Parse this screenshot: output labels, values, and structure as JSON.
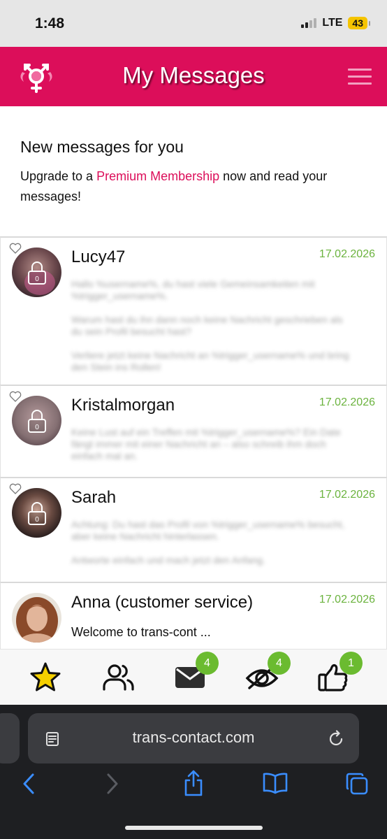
{
  "status_bar": {
    "time": "1:48",
    "network": "LTE",
    "battery": "43"
  },
  "header": {
    "title": "My Messages",
    "logo_icon": "trans-symbol-icon",
    "menu_icon": "hamburger-menu-icon"
  },
  "intro": {
    "heading": "New messages for you",
    "text_before": "Upgrade to a ",
    "link_label": "Premium Membership",
    "text_after": " now and read your messages!"
  },
  "messages": [
    {
      "name": "Lucy47",
      "date": "17.02.2026",
      "lock_count": "0",
      "preview": [
        "Hallo %username%, du hast viele Gemeinsamkeiten mit %trigger_username%.",
        "Warum hast du ihn dann noch keine Nachricht geschrieben als du sein Profil besucht hast?",
        "Verliere jetzt keine Nachricht an %trigger_username% und bring den Stein ins Rollen!"
      ]
    },
    {
      "name": "Kristalmorgan",
      "date": "17.02.2026",
      "lock_count": "0",
      "preview": [
        "Keine Lust auf ein Treffen mit %trigger_username%? Ein Date fängt immer mit einer Nachricht an – also schreib ihm doch einfach mal an."
      ]
    },
    {
      "name": "Sarah",
      "date": "17.02.2026",
      "lock_count": "0",
      "preview": [
        "Achtung: Du hast das Profil von %trigger_username% besucht, aber keine Nachricht hinterlassen.",
        "Antworte einfach und mach jetzt den Anfang."
      ]
    },
    {
      "name": "Anna (customer service)",
      "date": "17.02.2026",
      "preview_text": "Welcome to trans-cont ..."
    }
  ],
  "bottom_nav": [
    {
      "icon": "star-icon",
      "badge": null
    },
    {
      "icon": "users-icon",
      "badge": null
    },
    {
      "icon": "mail-icon",
      "badge": "4"
    },
    {
      "icon": "eye-icon",
      "badge": "4"
    },
    {
      "icon": "thumbs-up-icon",
      "badge": "1"
    }
  ],
  "browser": {
    "url": "trans-contact.com"
  },
  "colors": {
    "brand": "#dc0e5a",
    "date_green": "#6bb33e",
    "badge_green": "#6bbb30",
    "star_yellow": "#f5d000"
  }
}
